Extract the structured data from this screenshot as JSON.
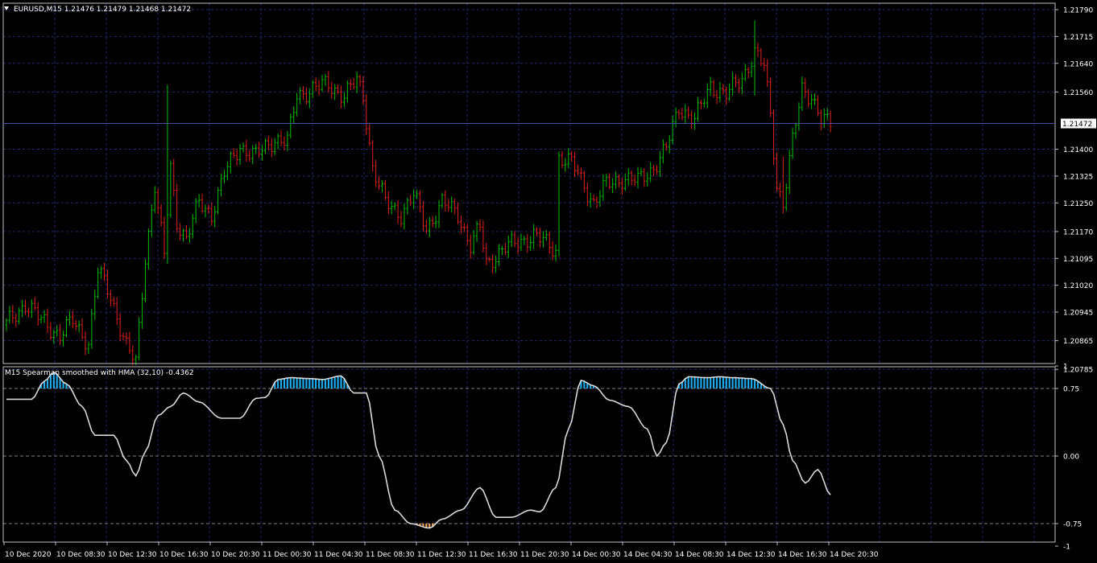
{
  "window": {
    "symbol_header": "EURUSD,M15  1.21476 1.21479 1.21468 1.21472",
    "indicator_header": "M15 Spearman smoothed with HMA (32,10) -0.4362"
  },
  "colors": {
    "background": "#000000",
    "grid": "#1e2a6e",
    "frame": "#c0c0c0",
    "bull": "#00c000",
    "bear": "#e02020",
    "indicator_line": "#d8d8d8",
    "overbought_fill": "#20a8e8",
    "oversold_fill": "#f0a060",
    "price_line": "#4050a0",
    "price_tag_bg": "#ffffff",
    "price_tag_text": "#000000"
  },
  "price_axis": {
    "ticks": [
      "1.21790",
      "1.21715",
      "1.21640",
      "1.21560",
      "1.21400",
      "1.21325",
      "1.21250",
      "1.21170",
      "1.21095",
      "1.21020",
      "1.20945",
      "1.20865",
      "1.20785"
    ],
    "tick_values": [
      1.2179,
      1.21715,
      1.2164,
      1.2156,
      1.214,
      1.21325,
      1.2125,
      1.2117,
      1.21095,
      1.2102,
      1.20945,
      1.20865,
      1.20785
    ],
    "current_price": "1.21472",
    "current_value": 1.21472
  },
  "indicator_axis": {
    "ticks": [
      "1",
      "0.75",
      "0.00",
      "-0.75",
      "-1"
    ],
    "tick_values": [
      1,
      0.75,
      0,
      -0.75,
      -1
    ]
  },
  "time_axis": {
    "labels": [
      "10 Dec 2020",
      "10 Dec 08:30",
      "10 Dec 12:30",
      "10 Dec 16:30",
      "10 Dec 20:30",
      "11 Dec 00:30",
      "11 Dec 04:30",
      "11 Dec 08:30",
      "11 Dec 12:30",
      "11 Dec 16:30",
      "11 Dec 20:30",
      "14 Dec 00:30",
      "14 Dec 04:30",
      "14 Dec 08:30",
      "14 Dec 12:30",
      "14 Dec 16:30",
      "14 Dec 20:30"
    ]
  },
  "chart_data": [
    {
      "type": "bar",
      "description": "EURUSD M15 OHLC bars, approximate close path",
      "close_path": [
        {
          "bar": 0,
          "price": 1.2091
        },
        {
          "bar": 6,
          "price": 1.2097
        },
        {
          "bar": 10,
          "price": 1.2093
        },
        {
          "bar": 17,
          "price": 1.2088
        },
        {
          "bar": 21,
          "price": 1.2092
        },
        {
          "bar": 26,
          "price": 1.2086
        },
        {
          "bar": 29,
          "price": 1.2106
        },
        {
          "bar": 33,
          "price": 1.2099
        },
        {
          "bar": 38,
          "price": 1.2085
        },
        {
          "bar": 41,
          "price": 1.208
        },
        {
          "bar": 44,
          "price": 1.211
        },
        {
          "bar": 47,
          "price": 1.213
        },
        {
          "bar": 50,
          "price": 1.211
        },
        {
          "bar": 52,
          "price": 1.2135
        },
        {
          "bar": 54,
          "price": 1.212
        },
        {
          "bar": 57,
          "price": 1.2115
        },
        {
          "bar": 61,
          "price": 1.2125
        },
        {
          "bar": 65,
          "price": 1.2122
        },
        {
          "bar": 69,
          "price": 1.2133
        },
        {
          "bar": 74,
          "price": 1.2141
        },
        {
          "bar": 79,
          "price": 1.2138
        },
        {
          "bar": 85,
          "price": 1.2143
        },
        {
          "bar": 89,
          "price": 1.2142
        },
        {
          "bar": 92,
          "price": 1.2155
        },
        {
          "bar": 97,
          "price": 1.2157
        },
        {
          "bar": 102,
          "price": 1.2158
        },
        {
          "bar": 107,
          "price": 1.2155
        },
        {
          "bar": 111,
          "price": 1.2159
        },
        {
          "bar": 113,
          "price": 1.2155
        },
        {
          "bar": 116,
          "price": 1.2135
        },
        {
          "bar": 120,
          "price": 1.2125
        },
        {
          "bar": 125,
          "price": 1.2122
        },
        {
          "bar": 129,
          "price": 1.2127
        },
        {
          "bar": 133,
          "price": 1.2118
        },
        {
          "bar": 138,
          "price": 1.2125
        },
        {
          "bar": 143,
          "price": 1.2122
        },
        {
          "bar": 147,
          "price": 1.2113
        },
        {
          "bar": 150,
          "price": 1.2118
        },
        {
          "bar": 152,
          "price": 1.2108
        },
        {
          "bar": 157,
          "price": 1.2112
        },
        {
          "bar": 162,
          "price": 1.2114
        },
        {
          "bar": 167,
          "price": 1.2116
        },
        {
          "bar": 172,
          "price": 1.2113
        },
        {
          "bar": 174,
          "price": 1.2112
        },
        {
          "bar": 175,
          "price": 1.2138
        },
        {
          "bar": 179,
          "price": 1.2136
        },
        {
          "bar": 183,
          "price": 1.213
        },
        {
          "bar": 186,
          "price": 1.2125
        },
        {
          "bar": 190,
          "price": 1.213
        },
        {
          "bar": 195,
          "price": 1.2132
        },
        {
          "bar": 200,
          "price": 1.2131
        },
        {
          "bar": 205,
          "price": 1.2135
        },
        {
          "bar": 209,
          "price": 1.214
        },
        {
          "bar": 213,
          "price": 1.2152
        },
        {
          "bar": 218,
          "price": 1.2148
        },
        {
          "bar": 223,
          "price": 1.2158
        },
        {
          "bar": 228,
          "price": 1.2155
        },
        {
          "bar": 233,
          "price": 1.216
        },
        {
          "bar": 237,
          "price": 1.2167
        },
        {
          "bar": 240,
          "price": 1.2163
        },
        {
          "bar": 242,
          "price": 1.215
        },
        {
          "bar": 244,
          "price": 1.213
        },
        {
          "bar": 246,
          "price": 1.2125
        },
        {
          "bar": 249,
          "price": 1.2142
        },
        {
          "bar": 252,
          "price": 1.2157
        },
        {
          "bar": 255,
          "price": 1.2155
        },
        {
          "bar": 258,
          "price": 1.2148
        },
        {
          "bar": 261,
          "price": 1.2147
        }
      ],
      "spikes": [
        {
          "bar": 51,
          "high": 1.2158,
          "low": 1.2108
        },
        {
          "bar": 237,
          "high": 1.2176,
          "low": 1.2155
        },
        {
          "bar": 246,
          "high": 1.2138,
          "low": 1.2122
        }
      ]
    },
    {
      "type": "line",
      "description": "Spearman smoothed with HMA (32,10)",
      "ylim": [
        -1,
        1
      ],
      "levels": [
        0.75,
        0,
        -0.75
      ],
      "points": [
        {
          "bar": 0,
          "value": 0.63
        },
        {
          "bar": 8,
          "value": 0.63
        },
        {
          "bar": 12,
          "value": 0.83
        },
        {
          "bar": 15,
          "value": 0.93
        },
        {
          "bar": 19,
          "value": 0.8
        },
        {
          "bar": 24,
          "value": 0.55
        },
        {
          "bar": 28,
          "value": 0.23
        },
        {
          "bar": 34,
          "value": 0.23
        },
        {
          "bar": 38,
          "value": -0.05
        },
        {
          "bar": 41,
          "value": -0.22
        },
        {
          "bar": 44,
          "value": 0.05
        },
        {
          "bar": 48,
          "value": 0.45
        },
        {
          "bar": 52,
          "value": 0.55
        },
        {
          "bar": 56,
          "value": 0.7
        },
        {
          "bar": 61,
          "value": 0.6
        },
        {
          "bar": 68,
          "value": 0.42
        },
        {
          "bar": 74,
          "value": 0.42
        },
        {
          "bar": 79,
          "value": 0.64
        },
        {
          "bar": 82,
          "value": 0.65
        },
        {
          "bar": 86,
          "value": 0.85
        },
        {
          "bar": 90,
          "value": 0.87
        },
        {
          "bar": 96,
          "value": 0.86
        },
        {
          "bar": 100,
          "value": 0.85
        },
        {
          "bar": 106,
          "value": 0.89
        },
        {
          "bar": 110,
          "value": 0.7
        },
        {
          "bar": 114,
          "value": 0.7
        },
        {
          "bar": 118,
          "value": 0.0
        },
        {
          "bar": 123,
          "value": -0.6
        },
        {
          "bar": 128,
          "value": -0.75
        },
        {
          "bar": 134,
          "value": -0.8
        },
        {
          "bar": 138,
          "value": -0.7
        },
        {
          "bar": 144,
          "value": -0.6
        },
        {
          "bar": 150,
          "value": -0.35
        },
        {
          "bar": 155,
          "value": -0.68
        },
        {
          "bar": 160,
          "value": -0.68
        },
        {
          "bar": 166,
          "value": -0.6
        },
        {
          "bar": 169,
          "value": -0.62
        },
        {
          "bar": 174,
          "value": -0.35
        },
        {
          "bar": 178,
          "value": 0.3
        },
        {
          "bar": 182,
          "value": 0.84
        },
        {
          "bar": 186,
          "value": 0.78
        },
        {
          "bar": 191,
          "value": 0.62
        },
        {
          "bar": 197,
          "value": 0.55
        },
        {
          "bar": 203,
          "value": 0.3
        },
        {
          "bar": 206,
          "value": 0.0
        },
        {
          "bar": 209,
          "value": 0.15
        },
        {
          "bar": 213,
          "value": 0.8
        },
        {
          "bar": 216,
          "value": 0.88
        },
        {
          "bar": 222,
          "value": 0.87
        },
        {
          "bar": 226,
          "value": 0.88
        },
        {
          "bar": 230,
          "value": 0.87
        },
        {
          "bar": 236,
          "value": 0.86
        },
        {
          "bar": 242,
          "value": 0.75
        },
        {
          "bar": 246,
          "value": 0.35
        },
        {
          "bar": 249,
          "value": -0.05
        },
        {
          "bar": 253,
          "value": -0.3
        },
        {
          "bar": 257,
          "value": -0.15
        },
        {
          "bar": 261,
          "value": -0.43
        }
      ]
    }
  ]
}
